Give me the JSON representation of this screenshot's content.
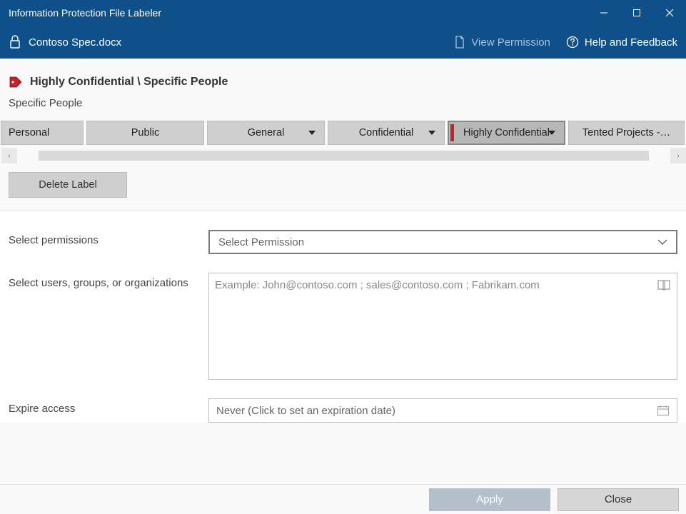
{
  "window": {
    "title": "Information Protection File Labeler"
  },
  "toolbar": {
    "filename": "Contoso Spec.docx",
    "view_permission": "View Permission",
    "help_feedback": "Help and Feedback"
  },
  "label_header": {
    "breadcrumb": "Highly Confidential  \\ Specific People",
    "sublabel": "Specific People"
  },
  "categories": [
    {
      "label": "Personal",
      "has_dropdown": false,
      "selected": false
    },
    {
      "label": "Public",
      "has_dropdown": false,
      "selected": false
    },
    {
      "label": "General",
      "has_dropdown": true,
      "selected": false
    },
    {
      "label": "Confidential",
      "has_dropdown": true,
      "selected": false
    },
    {
      "label": "Highly Confidential",
      "has_dropdown": true,
      "selected": true
    },
    {
      "label": "Tented Projects -…",
      "has_dropdown": false,
      "selected": false
    }
  ],
  "delete_label": "Delete Label",
  "form": {
    "select_permissions_label": "Select permissions",
    "select_permissions_placeholder": "Select Permission",
    "select_users_label": "Select users, groups, or organizations",
    "select_users_placeholder": "Example: John@contoso.com ; sales@contoso.com ; Fabrikam.com",
    "expire_label": "Expire access",
    "expire_placeholder": "Never (Click to set an expiration date)"
  },
  "footer": {
    "apply": "Apply",
    "close": "Close"
  }
}
